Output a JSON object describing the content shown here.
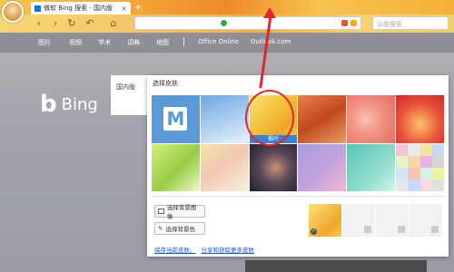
{
  "browser": {
    "tab_title": "微软 Bing 搜索 - 国内版",
    "tab_close": "×",
    "new_tab": "+",
    "search_placeholder": "谷歌搜索",
    "nav": {
      "back": "‹",
      "forward": "›",
      "reload": "↻",
      "home": "⌂",
      "undo": "↶"
    }
  },
  "bing": {
    "links": [
      "图片",
      "视频",
      "学术",
      "词典",
      "地图",
      "Office Online",
      "Outlook.com"
    ],
    "logo_text": "Bing",
    "domestic_tab": "国内版"
  },
  "skin_panel": {
    "title": "选择皮肤",
    "selected_tile_label": "枫叶",
    "choose_image_button": "选择背景图像",
    "choose_color_button": "选择背景色",
    "save_link": "保存当前皮肤。",
    "share_link": "分享和获取更多皮肤",
    "mosaic_colors": [
      "#f3c4cf",
      "#e9e9e9",
      "#f4e59a",
      "#c6dbf2",
      "#e5f4c7",
      "#f8d7a6",
      "#e9b4e3",
      "#d6d6d6",
      "#cfe8f7",
      "#f5c6b1",
      "#d3f1e5",
      "#f2f2a7",
      "#e7e7e7",
      "#c9d9f8",
      "#f7d9e6",
      "#e0e0e0"
    ]
  },
  "colors": {
    "annotation": "#e02828",
    "selected_label_bg": "#3b7ed3"
  }
}
